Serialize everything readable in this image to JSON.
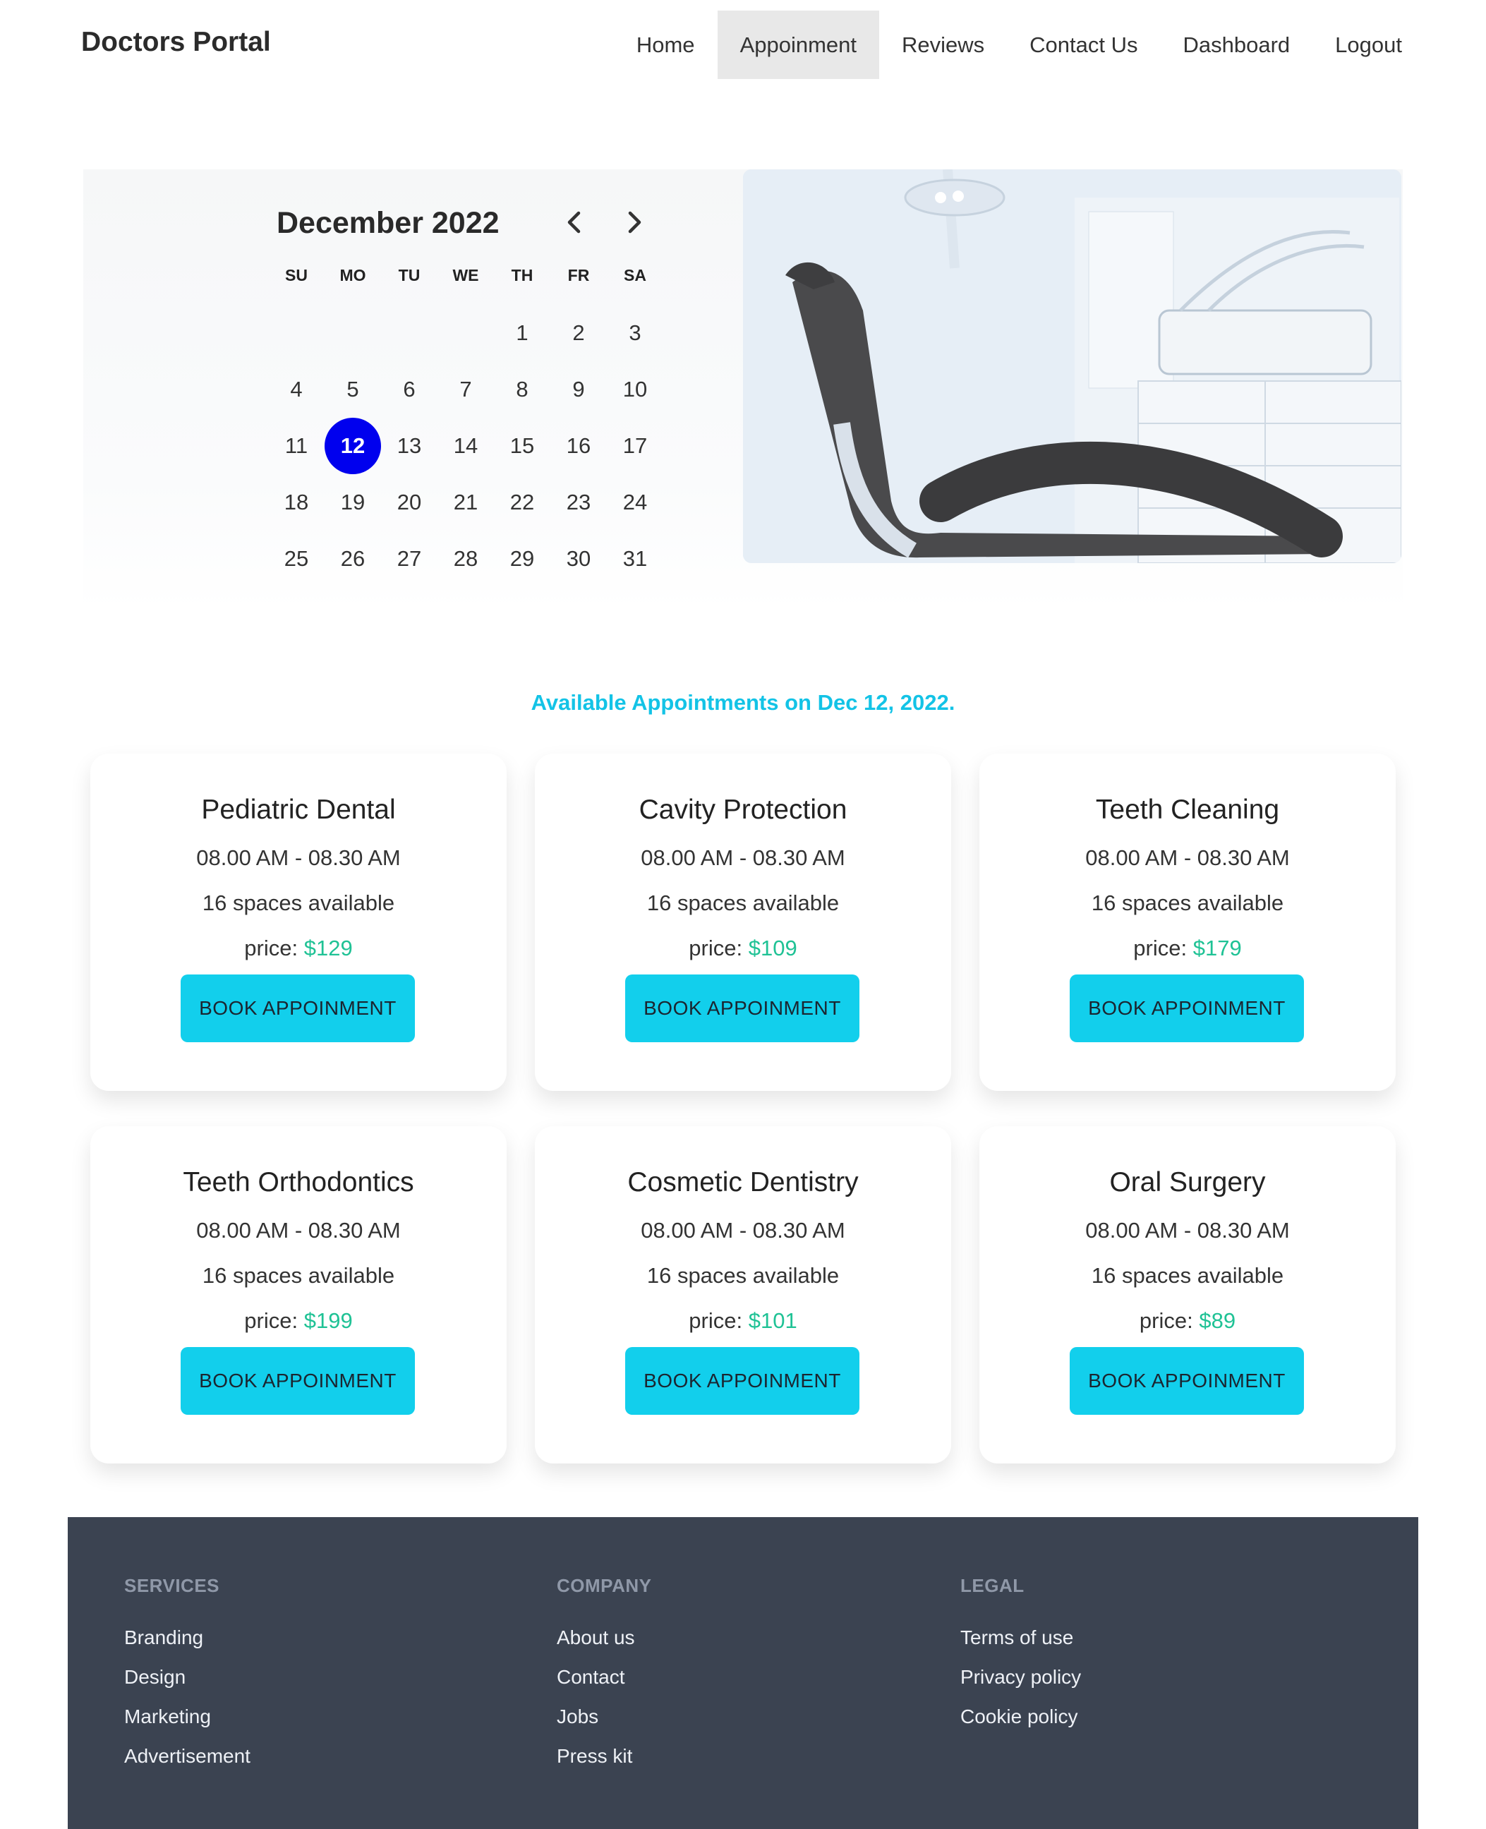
{
  "nav": {
    "brand": "Doctors Portal",
    "items": [
      {
        "label": "Home",
        "active": false
      },
      {
        "label": "Appoinment",
        "active": true
      },
      {
        "label": "Reviews",
        "active": false
      },
      {
        "label": "Contact Us",
        "active": false
      },
      {
        "label": "Dashboard",
        "active": false
      },
      {
        "label": "Logout",
        "active": false
      }
    ]
  },
  "calendar": {
    "title": "December 2022",
    "prev_icon": "chevron-left-icon",
    "next_icon": "chevron-right-icon",
    "weekdays": [
      "SU",
      "MO",
      "TU",
      "WE",
      "TH",
      "FR",
      "SA"
    ],
    "leading_blanks": 4,
    "days_in_month": 31,
    "selected_day": 12,
    "selected_color": "#0000ee"
  },
  "hero_image": "dental-chair-photo",
  "available_heading": "Available Appointments on Dec 12, 2022.",
  "services": [
    {
      "name": "Pediatric Dental",
      "time": "08.00 AM - 08.30 AM",
      "spaces": "16 spaces available",
      "price_label": "price:",
      "price": "$129",
      "button": "BOOK APPOINMENT"
    },
    {
      "name": "Cavity Protection",
      "time": "08.00 AM - 08.30 AM",
      "spaces": "16 spaces available",
      "price_label": "price:",
      "price": "$109",
      "button": "BOOK APPOINMENT"
    },
    {
      "name": "Teeth Cleaning",
      "time": "08.00 AM - 08.30 AM",
      "spaces": "16 spaces available",
      "price_label": "price:",
      "price": "$179",
      "button": "BOOK APPOINMENT"
    },
    {
      "name": "Teeth Orthodontics",
      "time": "08.00 AM - 08.30 AM",
      "spaces": "16 spaces available",
      "price_label": "price:",
      "price": "$199",
      "button": "BOOK APPOINMENT"
    },
    {
      "name": "Cosmetic Dentistry",
      "time": "08.00 AM - 08.30 AM",
      "spaces": "16 spaces available",
      "price_label": "price:",
      "price": "$101",
      "button": "BOOK APPOINMENT"
    },
    {
      "name": "Oral Surgery",
      "time": "08.00 AM - 08.30 AM",
      "spaces": "16 spaces available",
      "price_label": "price:",
      "price": "$89",
      "button": "BOOK APPOINMENT"
    }
  ],
  "colors": {
    "accent": "#12cfec",
    "heading": "#13c3e6",
    "price": "#1fc295",
    "footer_bg": "#3b4351"
  },
  "footer": {
    "services": {
      "title": "SERVICES",
      "links": [
        "Branding",
        "Design",
        "Marketing",
        "Advertisement"
      ]
    },
    "company": {
      "title": "COMPANY",
      "links": [
        "About us",
        "Contact",
        "Jobs",
        "Press kit"
      ]
    },
    "legal": {
      "title": "LEGAL",
      "links": [
        "Terms of use",
        "Privacy policy",
        "Cookie policy"
      ]
    }
  }
}
